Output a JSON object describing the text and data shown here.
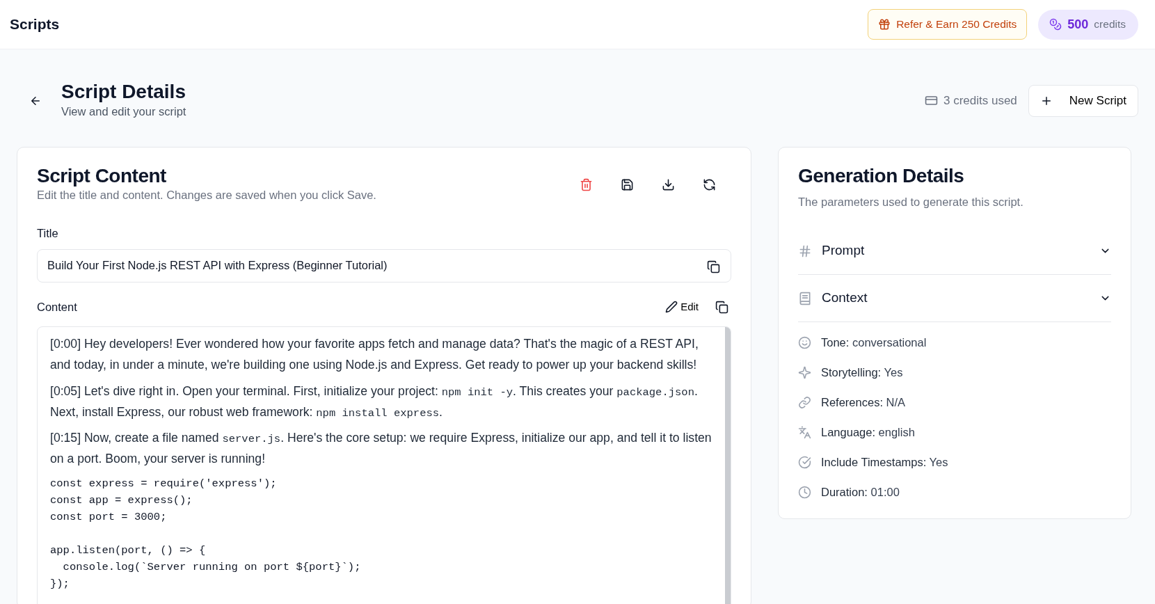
{
  "header": {
    "title": "Scripts",
    "refer_button": "Refer & Earn 250 Credits",
    "credits": {
      "amount": "500",
      "label": "credits"
    }
  },
  "page": {
    "title": "Script Details",
    "subtitle": "View and edit your script",
    "credits_used": "3 credits used",
    "new_button": "New Script"
  },
  "editor": {
    "title": "Script Content",
    "subtitle": "Edit the title and content. Changes are saved when you click Save.",
    "title_label": "Title",
    "title_value": "Build Your First Node.js REST API with Express (Beginner Tutorial)",
    "content_label": "Content",
    "edit_button": "Edit",
    "content": [
      {
        "kind": "paragraph",
        "parts": [
          {
            "text": "[0:00] Hey developers! Ever wondered how your favorite apps fetch and manage data? That's the magic of a REST API, and today, in under a minute, we're building one using Node.js and Express. Get ready to power up your backend skills!",
            "code": false
          }
        ]
      },
      {
        "kind": "paragraph",
        "parts": [
          {
            "text": "[0:05] Let's dive right in. Open your terminal. First, initialize your project: ",
            "code": false
          },
          {
            "text": "npm init -y",
            "code": true
          },
          {
            "text": ". This creates your ",
            "code": false
          },
          {
            "text": "package.json",
            "code": true
          },
          {
            "text": ". Next, install Express, our robust web framework: ",
            "code": false
          },
          {
            "text": "npm install express",
            "code": true
          },
          {
            "text": ".",
            "code": false
          }
        ]
      },
      {
        "kind": "paragraph",
        "parts": [
          {
            "text": "[0:15] Now, create a file named ",
            "code": false
          },
          {
            "text": "server.js",
            "code": true
          },
          {
            "text": ". Here's the core setup: we require Express, initialize our app, and tell it to listen on a port. Boom, your server is running!",
            "code": false
          }
        ]
      },
      {
        "kind": "code",
        "text": "const express = require('express');\nconst app = express();\nconst port = 3000;\n\napp.listen(port, () => {\n  console.log(`Server running on port ${port}`);\n});"
      }
    ]
  },
  "details": {
    "title": "Generation Details",
    "subtitle": "The parameters used to generate this script.",
    "sections": [
      {
        "kind": "prompt",
        "label": "Prompt",
        "expanded": false
      },
      {
        "kind": "context",
        "label": "Context",
        "expanded": false
      }
    ],
    "items": [
      {
        "kind": "tone",
        "label": "Tone:",
        "value": "conversational"
      },
      {
        "kind": "storytelling",
        "label": "Storytelling:",
        "value": "Yes"
      },
      {
        "kind": "references",
        "label": "References:",
        "value": "N/A"
      },
      {
        "kind": "language",
        "label": "Language:",
        "value": "english"
      },
      {
        "kind": "timestamps",
        "label": "Include Timestamps:",
        "value": "Yes"
      },
      {
        "kind": "duration",
        "label": "Duration:",
        "value": "01:00"
      }
    ]
  }
}
